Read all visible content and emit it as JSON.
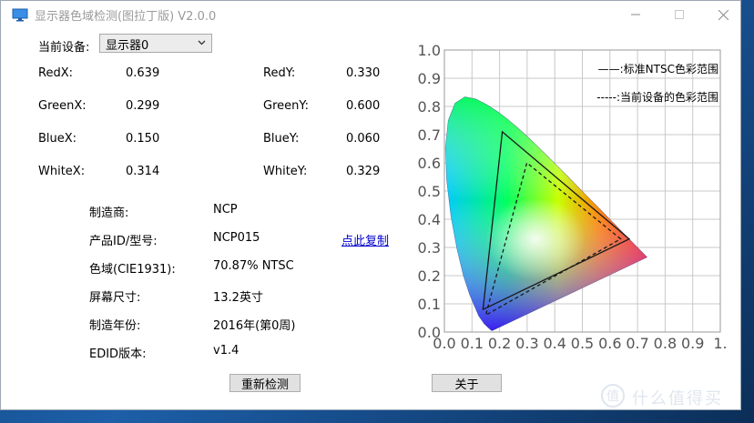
{
  "window": {
    "title": "显示器色域检测(图拉丁版) V2.0.0",
    "controls": {
      "minimize": "—",
      "maximize": "☐",
      "close": "✕"
    }
  },
  "device": {
    "label": "当前设备:",
    "selected": "显示器0"
  },
  "coords": [
    {
      "name": "RedX:",
      "value": "0.639"
    },
    {
      "name": "RedY:",
      "value": "0.330"
    },
    {
      "name": "GreenX:",
      "value": "0.299"
    },
    {
      "name": "GreenY:",
      "value": "0.600"
    },
    {
      "name": "BlueX:",
      "value": "0.150"
    },
    {
      "name": "BlueY:",
      "value": "0.060"
    },
    {
      "name": "WhiteX:",
      "value": "0.314"
    },
    {
      "name": "WhiteY:",
      "value": "0.329"
    }
  ],
  "info": [
    {
      "label": "制造商:",
      "value": "NCP"
    },
    {
      "label": "产品ID/型号:",
      "value": "NCP015"
    },
    {
      "label": "色域(CIE1931):",
      "value": "70.87% NTSC"
    },
    {
      "label": "屏幕尺寸:",
      "value": "13.2英寸"
    },
    {
      "label": "制造年份:",
      "value": "2016年(第0周)"
    },
    {
      "label": "EDID版本:",
      "value": "v1.4"
    }
  ],
  "copy_link": "点此复制",
  "buttons": {
    "redetect": "重新检测",
    "about": "关于"
  },
  "watermark": {
    "mark": "值",
    "text": "什么值得买"
  },
  "chart_data": {
    "type": "scatter",
    "title": "",
    "xlabel": "",
    "ylabel": "",
    "xlim": [
      0.0,
      1.0
    ],
    "ylim": [
      0.0,
      1.0
    ],
    "x_ticks": [
      "0.0",
      "0.1",
      "0.2",
      "0.3",
      "0.4",
      "0.5",
      "0.6",
      "0.7",
      "0.8",
      "0.9",
      "1."
    ],
    "y_ticks": [
      "0.0",
      "0.1",
      "0.2",
      "0.3",
      "0.4",
      "0.5",
      "0.6",
      "0.7",
      "0.8",
      "0.9",
      "1.0"
    ],
    "grid": true,
    "legend_position": "top-right",
    "series": [
      {
        "name": "——:标准NTSC色彩范围",
        "style": "solid",
        "points": [
          [
            0.67,
            0.33
          ],
          [
            0.21,
            0.71
          ],
          [
            0.14,
            0.08
          ]
        ]
      },
      {
        "name": "-----:当前设备的色彩范围",
        "style": "dashed",
        "points": [
          [
            0.639,
            0.33
          ],
          [
            0.299,
            0.6
          ],
          [
            0.15,
            0.06
          ]
        ]
      }
    ],
    "locus": [
      [
        0.1741,
        0.005
      ],
      [
        0.1738,
        0.0049
      ],
      [
        0.1733,
        0.0048
      ],
      [
        0.1726,
        0.0048
      ],
      [
        0.1714,
        0.0051
      ],
      [
        0.1689,
        0.0069
      ],
      [
        0.1644,
        0.0109
      ],
      [
        0.1566,
        0.0177
      ],
      [
        0.144,
        0.0297
      ],
      [
        0.1241,
        0.0578
      ],
      [
        0.0913,
        0.1327
      ],
      [
        0.0687,
        0.2007
      ],
      [
        0.0454,
        0.295
      ],
      [
        0.0235,
        0.4127
      ],
      [
        0.0082,
        0.5384
      ],
      [
        0.0039,
        0.6548
      ],
      [
        0.0139,
        0.7502
      ],
      [
        0.0389,
        0.812
      ],
      [
        0.0743,
        0.8338
      ],
      [
        0.1142,
        0.8262
      ],
      [
        0.1547,
        0.8059
      ],
      [
        0.1929,
        0.7816
      ],
      [
        0.2296,
        0.7543
      ],
      [
        0.2658,
        0.7243
      ],
      [
        0.3016,
        0.6923
      ],
      [
        0.3373,
        0.6589
      ],
      [
        0.3731,
        0.6245
      ],
      [
        0.4087,
        0.5896
      ],
      [
        0.4441,
        0.5547
      ],
      [
        0.4788,
        0.5202
      ],
      [
        0.5125,
        0.4866
      ],
      [
        0.5448,
        0.4544
      ],
      [
        0.5752,
        0.4242
      ],
      [
        0.6029,
        0.3965
      ],
      [
        0.627,
        0.3725
      ],
      [
        0.6482,
        0.3514
      ],
      [
        0.6658,
        0.334
      ],
      [
        0.6801,
        0.3197
      ],
      [
        0.6915,
        0.3083
      ],
      [
        0.7006,
        0.2993
      ],
      [
        0.7079,
        0.292
      ],
      [
        0.714,
        0.2859
      ],
      [
        0.719,
        0.2809
      ],
      [
        0.723,
        0.277
      ],
      [
        0.726,
        0.274
      ],
      [
        0.7283,
        0.2717
      ],
      [
        0.7347,
        0.2653
      ]
    ]
  }
}
